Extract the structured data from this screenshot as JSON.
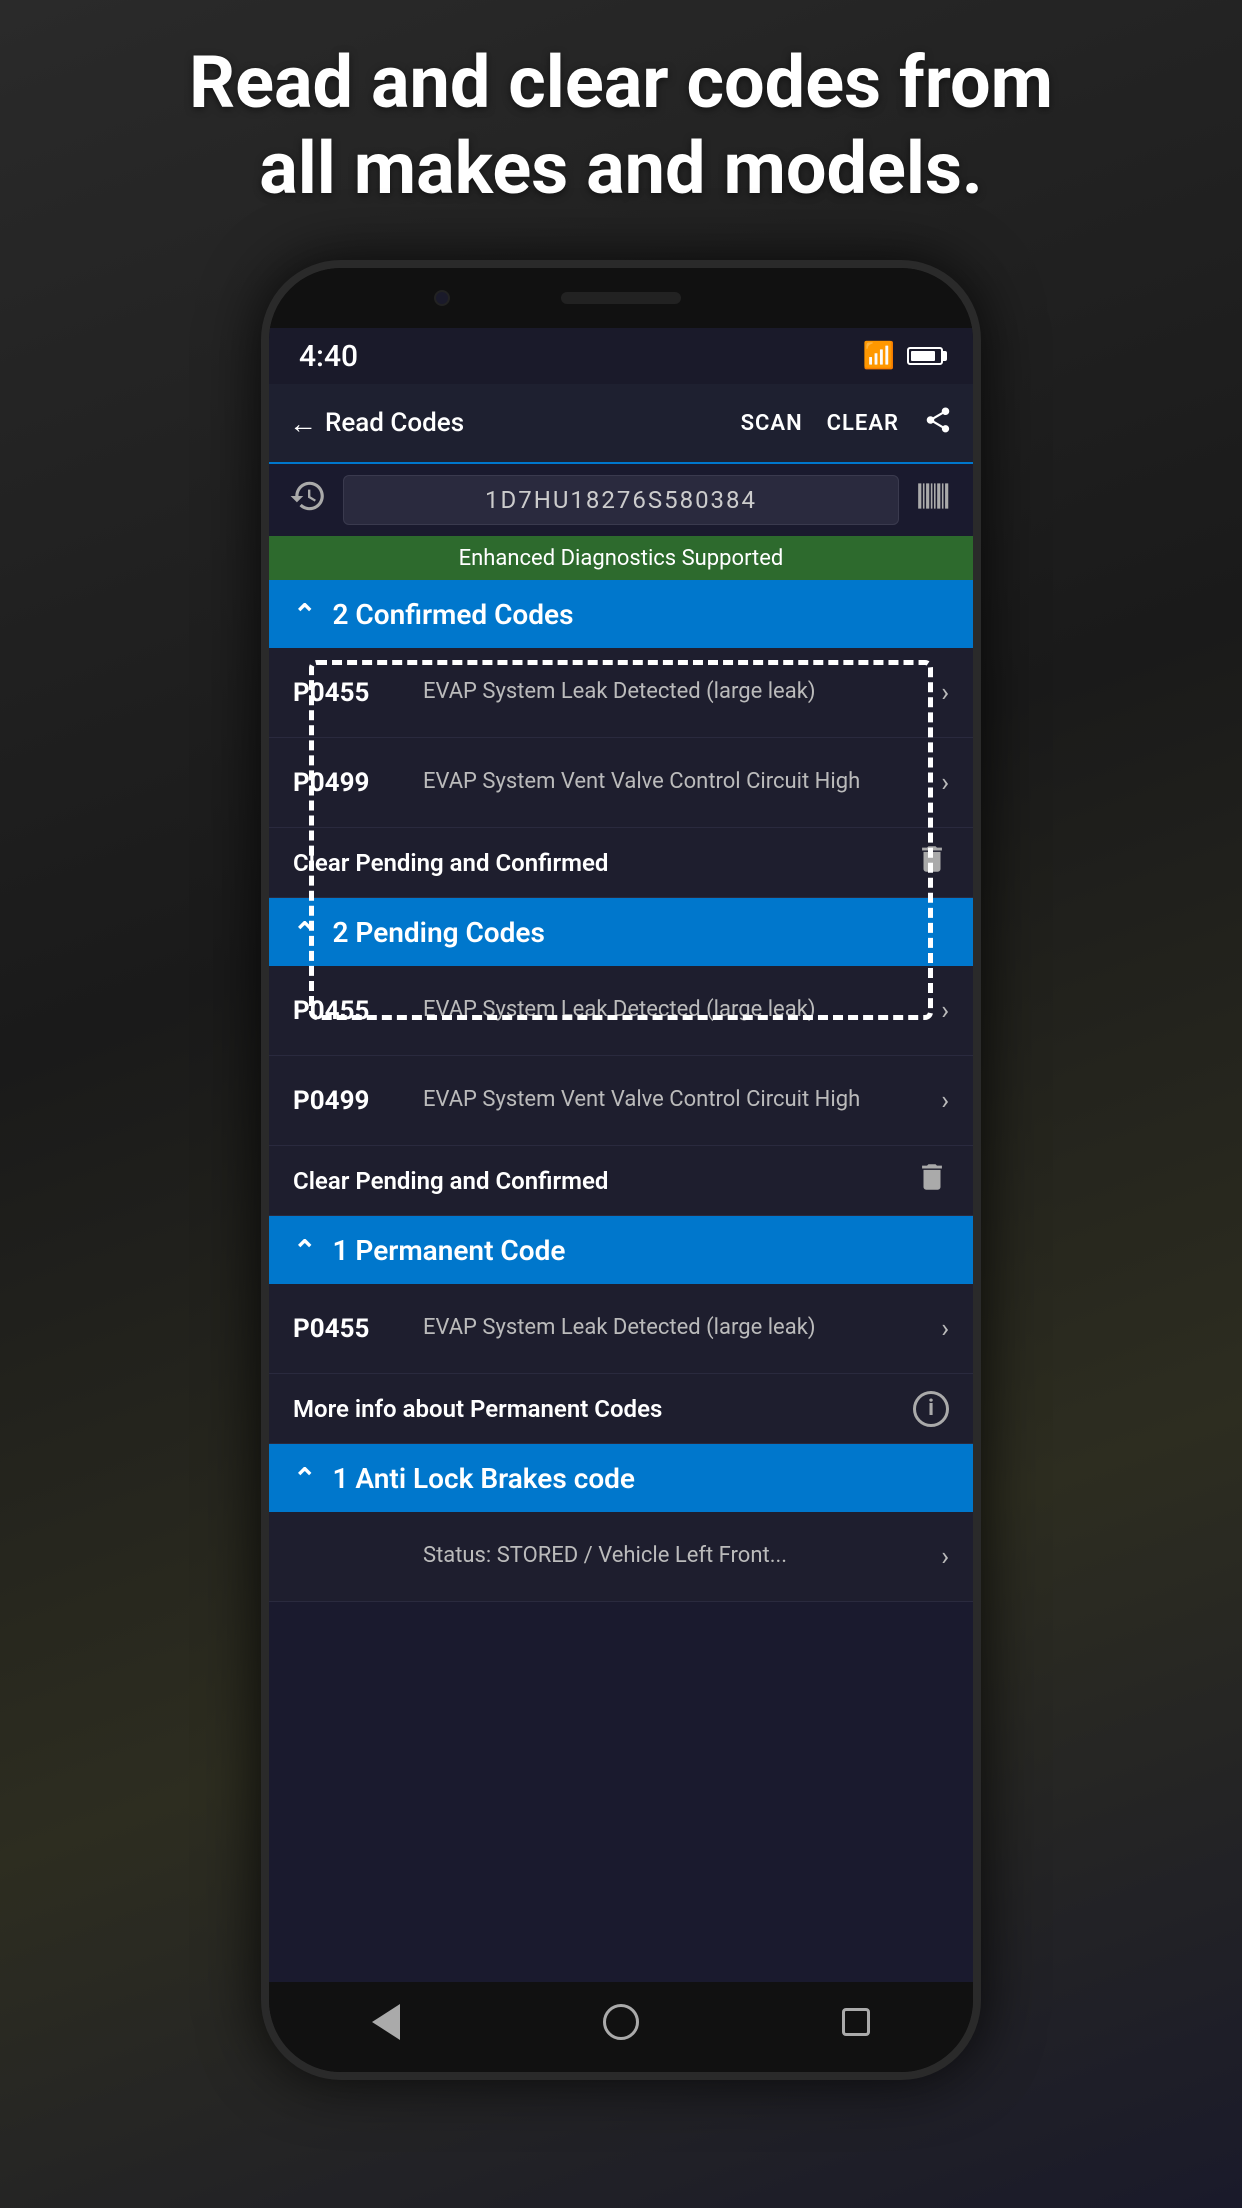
{
  "page": {
    "heading": "Read and clear codes from\nall makes and models.",
    "bg_color": "#1a1a1a"
  },
  "status_bar": {
    "time": "4:40",
    "wifi": "wifi",
    "battery_level": 70
  },
  "app_bar": {
    "back_label": "Read Codes",
    "scan_label": "SCAN",
    "clear_label": "CLEAR",
    "share_label": "share"
  },
  "vin_bar": {
    "vin": "1D7HU18276S580384",
    "history_icon": "history",
    "barcode_icon": "barcode"
  },
  "sections": [
    {
      "id": "enhanced-badge",
      "badge_text": "Enhanced Diagnostics Supported"
    },
    {
      "id": "confirmed",
      "header": "2 Confirmed Codes",
      "codes": [
        {
          "code": "P0455",
          "desc": "EVAP System Leak Detected (large leak)"
        },
        {
          "code": "P0499",
          "desc": "EVAP System Vent Valve Control Circuit High"
        }
      ],
      "clear_text": "Clear Pending and Confirmed"
    },
    {
      "id": "pending",
      "header": "2 Pending Codes",
      "codes": [
        {
          "code": "P0455",
          "desc": "EVAP System Leak Detected (large leak)"
        },
        {
          "code": "P0499",
          "desc": "EVAP System Vent Valve Control Circuit High"
        }
      ],
      "clear_text": "Clear Pending and Confirmed"
    },
    {
      "id": "permanent",
      "header": "1 Permanent Code",
      "codes": [
        {
          "code": "P0455",
          "desc": "EVAP System Leak Detected (large leak)"
        }
      ],
      "info_text": "More info about Permanent Codes"
    },
    {
      "id": "abs",
      "header": "1 Anti Lock Brakes code",
      "codes": [
        {
          "code": "",
          "desc": "Status: STORED / Vehicle Left Front..."
        }
      ]
    }
  ],
  "nav_bar": {
    "back": "back-triangle",
    "home": "home-circle",
    "recents": "recents-square"
  }
}
